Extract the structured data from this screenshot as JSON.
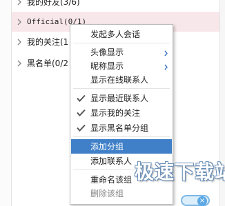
{
  "groups": [
    {
      "label": "我的好友(3/6)"
    },
    {
      "label": "Official(0/1)"
    },
    {
      "label": "我的关注(1"
    },
    {
      "label": "黑名单(0/2"
    }
  ],
  "menu": {
    "items": [
      {
        "label": "发起多人会话"
      },
      {
        "label": "头像显示",
        "submenu": true
      },
      {
        "label": "昵称显示",
        "submenu": true
      },
      {
        "label": "显示在线联系人"
      },
      {
        "label": "显示最近联系人",
        "checked": true
      },
      {
        "label": "显示我的关注",
        "checked": true
      },
      {
        "label": "显示黑名单分组",
        "checked": true
      },
      {
        "label": "添加分组",
        "highlighted": true
      },
      {
        "label": "添加联系人"
      },
      {
        "label": "重命名该组"
      },
      {
        "label": "删除该组"
      }
    ]
  },
  "watermark": {
    "text": "极速下载站"
  },
  "colors": {
    "selected_row": "#f8e7ea",
    "menu_highlight": "#3f80c8",
    "check": "#555555"
  }
}
